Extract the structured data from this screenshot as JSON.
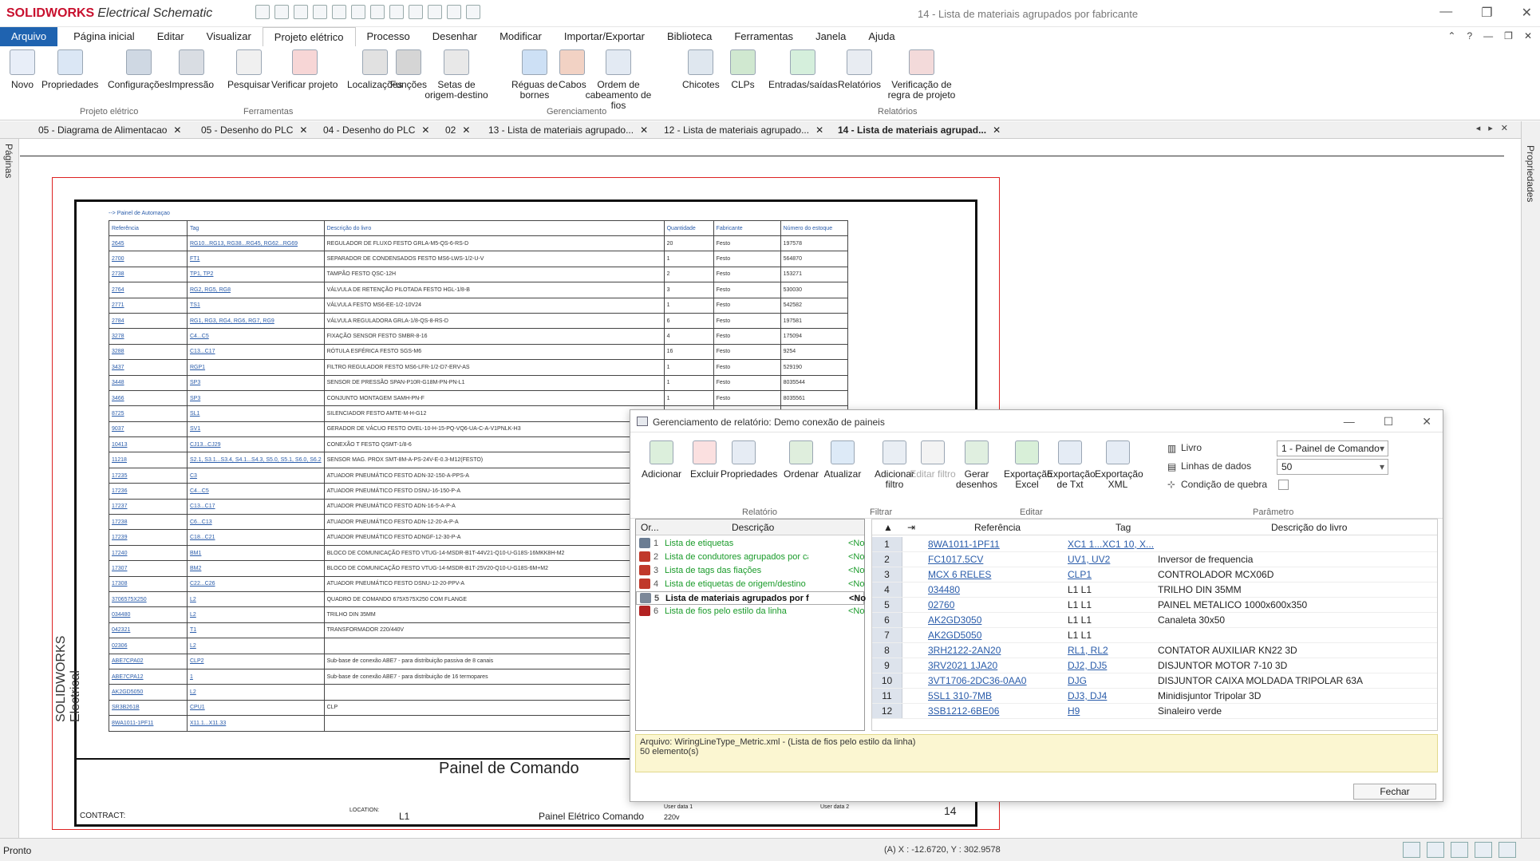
{
  "app": {
    "logo_brand": "SOLIDWORKS",
    "logo_product": "Electrical Schematic",
    "window_title": "14 - Lista de materiais agrupados por fabricante",
    "window_buttons": [
      "—",
      "❐",
      "✕"
    ]
  },
  "menu": {
    "file": "Arquivo",
    "items": [
      "Página inicial",
      "Editar",
      "Visualizar",
      "Projeto elétrico",
      "Processo",
      "Desenhar",
      "Modificar",
      "Importar/Exportar",
      "Biblioteca",
      "Ferramentas",
      "Janela",
      "Ajuda"
    ],
    "active": "Projeto elétrico",
    "right_controls": [
      "⌃",
      "?",
      "—",
      "❐",
      "✕"
    ]
  },
  "ribbon": {
    "buttons": [
      {
        "label": "Novo",
        "icon": "new-doc-icon",
        "color": "#e8eef8"
      },
      {
        "label": "Propriedades",
        "icon": "properties-icon",
        "color": "#dbe7f5"
      },
      {
        "label": "Configurações",
        "icon": "settings-icon",
        "color": "#cfd8e3"
      },
      {
        "label": "Impressão",
        "icon": "printer-icon",
        "color": "#d9dde3"
      },
      {
        "label": "Pesquisar",
        "icon": "search-icon",
        "color": "#f0f0f0"
      },
      {
        "label": "Verificar projeto",
        "icon": "check-project-icon",
        "color": "#f7d6d6"
      },
      {
        "label": "Localizações",
        "icon": "locations-icon",
        "color": "#e1e1e1"
      },
      {
        "label": "Funções",
        "icon": "functions-icon",
        "color": "#d5d5d5"
      },
      {
        "label": "Setas de origem-destino",
        "icon": "arrows-icon",
        "color": "#e8e8e8"
      },
      {
        "label": "Réguas de bornes",
        "icon": "terminal-strips-icon",
        "color": "#cde0f5"
      },
      {
        "label": "Cabos",
        "icon": "cables-icon",
        "color": "#f2d2c4"
      },
      {
        "label": "Ordem de cabeamento de fios",
        "icon": "wire-order-icon",
        "color": "#e3eaf3"
      },
      {
        "label": "Chicotes",
        "icon": "harness-icon",
        "color": "#dfe7ef"
      },
      {
        "label": "CLPs",
        "icon": "plc-icon",
        "color": "#d0e8d0"
      },
      {
        "label": "Entradas/saídas",
        "icon": "io-icon",
        "color": "#d5efdc"
      },
      {
        "label": "Relatórios",
        "icon": "reports-icon",
        "color": "#e8ecf2"
      },
      {
        "label": "Verificação de regra de projeto",
        "icon": "rule-check-icon",
        "color": "#f3dada"
      }
    ],
    "groups": [
      "Projeto elétrico",
      "Ferramentas",
      "Gerenciamento",
      "Relatórios"
    ]
  },
  "tabs": [
    {
      "label": "05 - Diagrama de Alimentacao"
    },
    {
      "label": "05 - Desenho do PLC"
    },
    {
      "label": "04 - Desenho do PLC"
    },
    {
      "label": "02"
    },
    {
      "label": "13 - Lista de materiais agrupado..."
    },
    {
      "label": "12 - Lista de materiais agrupado..."
    },
    {
      "label": "14 - Lista de materiais agrupad..."
    }
  ],
  "side": {
    "left": "Páginas",
    "right": "Propriedades"
  },
  "drawing": {
    "caption": "--> Painel de Automaçao",
    "headers": [
      "Referência",
      "Tag",
      "Descrição do livro",
      "Quantidade",
      "Fabricante",
      "Número do estoque"
    ],
    "rows": [
      [
        "2645",
        "RG10...RG13, RG38...RG45, RG62...RG69",
        "REGULADOR DE FLUXO FESTO GRLA-M5-QS-6-RS-D",
        "20",
        "Festo",
        "197578"
      ],
      [
        "2700",
        "FT1",
        "SEPARADOR DE CONDENSADOS FESTO MS6-LWS-1/2-U-V",
        "1",
        "Festo",
        "564870"
      ],
      [
        "2738",
        "TP1, TP2",
        "TAMPÃO FESTO QSC-12H",
        "2",
        "Festo",
        "153271"
      ],
      [
        "2764",
        "RG2, RG5, RG8",
        "VÁLVULA DE RETENÇÃO PILOTADA FESTO HGL-1/8-B",
        "3",
        "Festo",
        "530030"
      ],
      [
        "2771",
        "TS1",
        "VÁLVULA FESTO MS6-EE-1/2-10V24",
        "1",
        "Festo",
        "542582"
      ],
      [
        "2784",
        "RG1, RG3, RG4, RG6, RG7, RG9",
        "VÁLVULA REGULADORA GRLA-1/8-QS-8-RS-D",
        "6",
        "Festo",
        "197581"
      ],
      [
        "3278",
        "C4...C5",
        "FIXAÇÃO SENSOR FESTO SMBR-8-16",
        "4",
        "Festo",
        "175094"
      ],
      [
        "3288",
        "C13...C17",
        "RÓTULA ESFÉRICA FESTO SGS-M6",
        "16",
        "Festo",
        "9254"
      ],
      [
        "3437",
        "RGP1",
        "FILTRO REGULADOR FESTO MS6-LFR-1/2-D7-ERV-AS",
        "1",
        "Festo",
        "529190"
      ],
      [
        "3448",
        "SP3",
        "SENSOR DE PRESSÃO SPAN-P10R-G18M-PN-PN-L1",
        "1",
        "Festo",
        "8035544"
      ],
      [
        "3466",
        "SP3",
        "CONJUNTO MONTAGEM SAMH-PN-F",
        "1",
        "Festo",
        "8035561"
      ],
      [
        "8725",
        "SL1",
        "SILENCIADOR FESTO AMTE-M-H-G12",
        "",
        "",
        ""
      ],
      [
        "9037",
        "SV1",
        "GERADOR DE VÁCUO FESTO OVEL-10-H-15-PQ-VQ6-UA-C-A-V1PNLK-H3",
        "",
        "",
        ""
      ],
      [
        "10413",
        "CJ13...CJ29",
        "CONEXÃO T FESTO QSMT-1/8-6",
        "",
        "",
        ""
      ],
      [
        "11218",
        "S2.1, S3.1...S3.4, S4.1...S4.3, S5.0, S5.1, S6.0, S6.2",
        "SENSOR MAG. PROX SMT-8M-A-PS-24V-E-0.3-M12(FESTO)",
        "",
        "",
        ""
      ],
      [
        "17235",
        "C3",
        "ATUADOR PNEUMÁTICO FESTO ADN-32-150-A-PPS-A",
        "",
        "",
        ""
      ],
      [
        "17236",
        "C4...C5",
        "ATUADOR PNEUMÁTICO FESTO DSNU-16-150-P-A",
        "",
        "",
        ""
      ],
      [
        "17237",
        "C13...C17",
        "ATUADOR PNEUMÁTICO FESTO ADN-16-5-A-P-A",
        "",
        "",
        ""
      ],
      [
        "17238",
        "C6...C13",
        "ATUADOR PNEUMÁTICO FESTO ADN-12-20-A-P-A",
        "",
        "",
        ""
      ],
      [
        "17239",
        "C18...C21",
        "ATUADOR PNEUMÁTICO FESTO ADNGF-12-30-P-A",
        "",
        "",
        ""
      ],
      [
        "17240",
        "BM1",
        "BLOCO DE COMUNICAÇÃO FESTO VTUG-14-MSDR-B1T-44V21-Q10-U-G18S-16MKK8H-M2",
        "",
        "",
        ""
      ],
      [
        "17307",
        "BM2",
        "BLOCO DE COMUNICAÇÃO FESTO VTUG-14-MSDR-B1T-25V20-Q10-U-G18S-6M+M2",
        "",
        "",
        ""
      ],
      [
        "17308",
        "C22...C26",
        "ATUADOR PNEUMÁTICO FESTO DSNU-12-20-PPV-A",
        "",
        "",
        ""
      ],
      [
        "3706575X250",
        "L2",
        "QUADRO DE COMANDO 675X575X250 COM FLANGE",
        "",
        "",
        ""
      ],
      [
        "034480",
        "L2",
        "TRILHO DIN 35MM",
        "",
        "",
        ""
      ],
      [
        "042321",
        "T1",
        "TRANSFORMADOR 220/440V",
        "",
        "",
        ""
      ],
      [
        "02306",
        "L2",
        "",
        "",
        "",
        ""
      ],
      [
        "ABE7CPA02",
        "CLP2",
        "Sub-base de conexão ABE7 - para distribuição passiva de 8 canais",
        "",
        "",
        ""
      ],
      [
        "ABE7CPA12",
        "1",
        "Sub-base de conexão ABE7 - para distribuição de 16 termopares",
        "",
        "",
        ""
      ],
      [
        "AK2GD5050",
        "L2",
        "",
        "",
        "",
        ""
      ],
      [
        "SR3B261B",
        "CPU1",
        "CLP",
        "",
        "",
        ""
      ],
      [
        "8WA1011-1PF11",
        "X11.1...X11.33",
        "",
        "",
        "",
        ""
      ]
    ],
    "vertical_label": "SOLIDWORKS Electrical",
    "title_block": {
      "title": "Painel de Comando",
      "contract": "CONTRACT:",
      "location_label": "LOCATION:",
      "location": "L1",
      "description": "Painel Elétrico Comando",
      "user_data1_label": "User data 1",
      "user_data1": "220v",
      "user_data2_label": "User data 2",
      "sheet": "14"
    }
  },
  "dialog": {
    "title": "Gerenciamento de relatório: Demo conexão de paineis",
    "buttons": [
      {
        "label": "Adicionar",
        "icon": "add-icon",
        "color": "#dcefdc",
        "disabled": false
      },
      {
        "label": "Excluir",
        "icon": "delete-icon",
        "color": "#fbe0e0",
        "disabled": false
      },
      {
        "label": "Propriedades",
        "icon": "properties-icon",
        "color": "#e6ecf4",
        "disabled": false
      },
      {
        "label": "Ordenar",
        "icon": "sort-icon",
        "color": "#dfeedd",
        "disabled": false
      },
      {
        "label": "Atualizar",
        "icon": "refresh-icon",
        "color": "#ddeaf7",
        "disabled": false
      },
      {
        "label": "Adicionar filtro",
        "icon": "filter-icon",
        "color": "#e9eef4",
        "disabled": false
      },
      {
        "label": "Editar filtro",
        "icon": "edit-filter-icon",
        "color": "#f3f3f3",
        "disabled": true
      },
      {
        "label": "Gerar desenhos",
        "icon": "generate-drawings-icon",
        "color": "#e0efe0",
        "disabled": false
      },
      {
        "label": "Exportação Excel",
        "icon": "excel-icon",
        "color": "#d8efd8",
        "disabled": false
      },
      {
        "label": "Exportação de Txt",
        "icon": "txt-icon",
        "color": "#e5ecf5",
        "disabled": false
      },
      {
        "label": "Exportação XML",
        "icon": "xml-icon",
        "color": "#e5ecf5",
        "disabled": false
      }
    ],
    "groups": [
      "Relatório",
      "Filtrar",
      "Editar",
      "Parâmetro"
    ],
    "param": {
      "book_label": "Livro",
      "book_value": "1 - Painel de Comando",
      "lines_label": "Linhas de dados",
      "lines_value": "50",
      "break_label": "Condição de quebra"
    },
    "list_headers": [
      "Or...",
      "Descrição"
    ],
    "list": [
      {
        "n": "1",
        "label": "Lista de etiquetas",
        "status": "<No",
        "color": "#6b7d93",
        "selected": false
      },
      {
        "n": "2",
        "label": "Lista de condutores agrupados por cabos",
        "status": "<No",
        "color": "#c0392b",
        "selected": false
      },
      {
        "n": "3",
        "label": "Lista de tags das fiações",
        "status": "<No",
        "color": "#c0392b",
        "selected": false
      },
      {
        "n": "4",
        "label": "Lista de etiquetas de origem/destino dos fios",
        "status": "<No",
        "color": "#c0392b",
        "selected": false
      },
      {
        "n": "5",
        "label": "Lista de materiais agrupados por fab...",
        "status": "<No",
        "color": "#7b8798",
        "selected": true
      },
      {
        "n": "6",
        "label": "Lista de fios pelo estilo da linha",
        "status": "<No",
        "color": "#b22222",
        "selected": false
      }
    ],
    "grid_headers": [
      "Referência",
      "Tag",
      "Descrição do livro"
    ],
    "grid": [
      {
        "n": "1",
        "ref": "8WA1011-1PF11",
        "tag": "XC1 1...XC1 10, X...",
        "tag_link": true,
        "desc": ""
      },
      {
        "n": "2",
        "ref": "FC1017.5CV",
        "tag": "UV1, UV2",
        "tag_link": true,
        "desc": "Inversor de frequencia"
      },
      {
        "n": "3",
        "ref": "MCX 6 RELES",
        "tag": "CLP1",
        "tag_link": true,
        "desc": "CONTROLADOR MCX06D"
      },
      {
        "n": "4",
        "ref": "034480",
        "tag": "L1 L1",
        "tag_link": false,
        "desc": "TRILHO DIN 35MM"
      },
      {
        "n": "5",
        "ref": "02760",
        "tag": "L1 L1",
        "tag_link": false,
        "desc": "PAINEL METALICO 1000x600x350"
      },
      {
        "n": "6",
        "ref": "AK2GD3050",
        "tag": "L1 L1",
        "tag_link": false,
        "desc": "Canaleta 30x50"
      },
      {
        "n": "7",
        "ref": "AK2GD5050",
        "tag": "L1 L1",
        "tag_link": false,
        "desc": ""
      },
      {
        "n": "8",
        "ref": "3RH2122-2AN20",
        "tag": "RL1, RL2",
        "tag_link": true,
        "desc": "CONTATOR AUXILIAR KN22 3D"
      },
      {
        "n": "9",
        "ref": "3RV2021 1JA20",
        "tag": "DJ2, DJ5",
        "tag_link": true,
        "desc": "DISJUNTOR MOTOR 7-10 3D"
      },
      {
        "n": "10",
        "ref": "3VT1706-2DC36-0AA0",
        "tag": "DJG",
        "tag_link": true,
        "desc": "DISJUNTOR CAIXA MOLDADA TRIPOLAR 63A"
      },
      {
        "n": "11",
        "ref": "5SL1 310-7MB",
        "tag": "DJ3, DJ4",
        "tag_link": true,
        "desc": "Minidisjuntor Tripolar 3D"
      },
      {
        "n": "12",
        "ref": "3SB1212-6BE06",
        "tag": "H9",
        "tag_link": true,
        "desc": "Sinaleiro verde"
      }
    ],
    "info_line1": "Arquivo: WiringLineType_Metric.xml - (Lista de fios pelo estilo da linha)",
    "info_line2": "50 elemento(s)",
    "close": "Fechar"
  },
  "status": {
    "left": "Pronto",
    "coords": "(A) X : -12.6720, Y : 302.9578"
  }
}
